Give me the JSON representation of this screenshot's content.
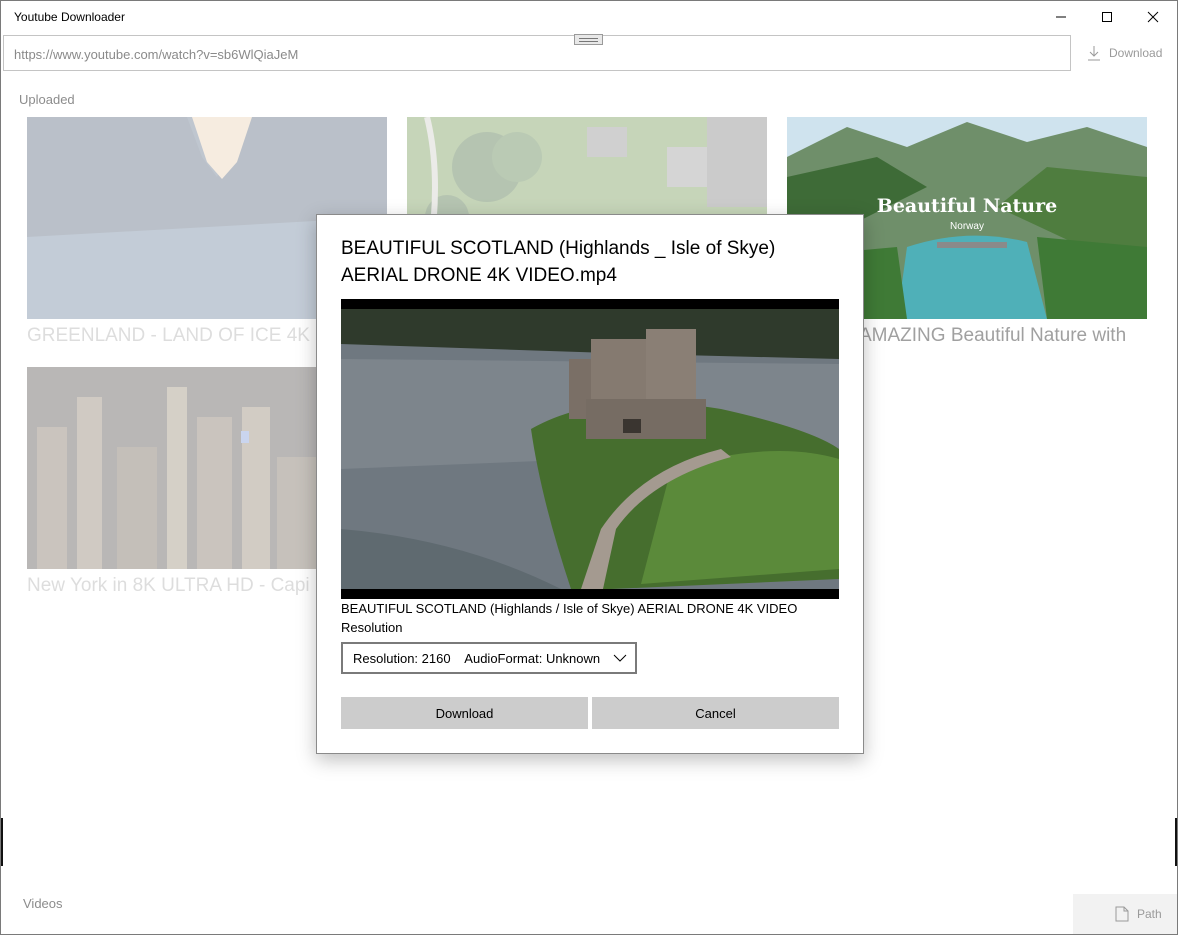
{
  "window": {
    "title": "Youtube Downloader"
  },
  "toolbar": {
    "url_value": "https://www.youtube.com/watch?v=sb6WlQiaJeM",
    "download_label": "Download"
  },
  "uploaded_section": {
    "label": "Uploaded",
    "videos": [
      {
        "title": "GREENLAND - LAND OF ICE 4K"
      },
      {
        "title": ""
      },
      {
        "title": "AMAZING Beautiful Nature with",
        "thumb_text": "Beautiful Nature",
        "thumb_subtext": "Norway"
      },
      {
        "title": "New York in 8K ULTRA HD - Capi"
      }
    ]
  },
  "footer": {
    "videos_label": "Videos",
    "path_label": "Path"
  },
  "dialog": {
    "title": "BEAUTIFUL SCOTLAND (Highlands _ Isle of Skye) AERIAL DRONE 4K VIDEO.mp4",
    "caption": "BEAUTIFUL SCOTLAND (Highlands / Isle of Skye) AERIAL DRONE 4K VIDEO",
    "resolution_label": "Resolution",
    "format_selected": "Resolution: 2160    AudioFormat: Unknown",
    "download_label": "Download",
    "cancel_label": "Cancel"
  },
  "icons": {
    "minimize": "minimize-icon",
    "maximize": "maximize-icon",
    "close": "close-icon",
    "download": "download-icon",
    "path": "document-icon",
    "dropdown": "chevron-down-icon"
  }
}
